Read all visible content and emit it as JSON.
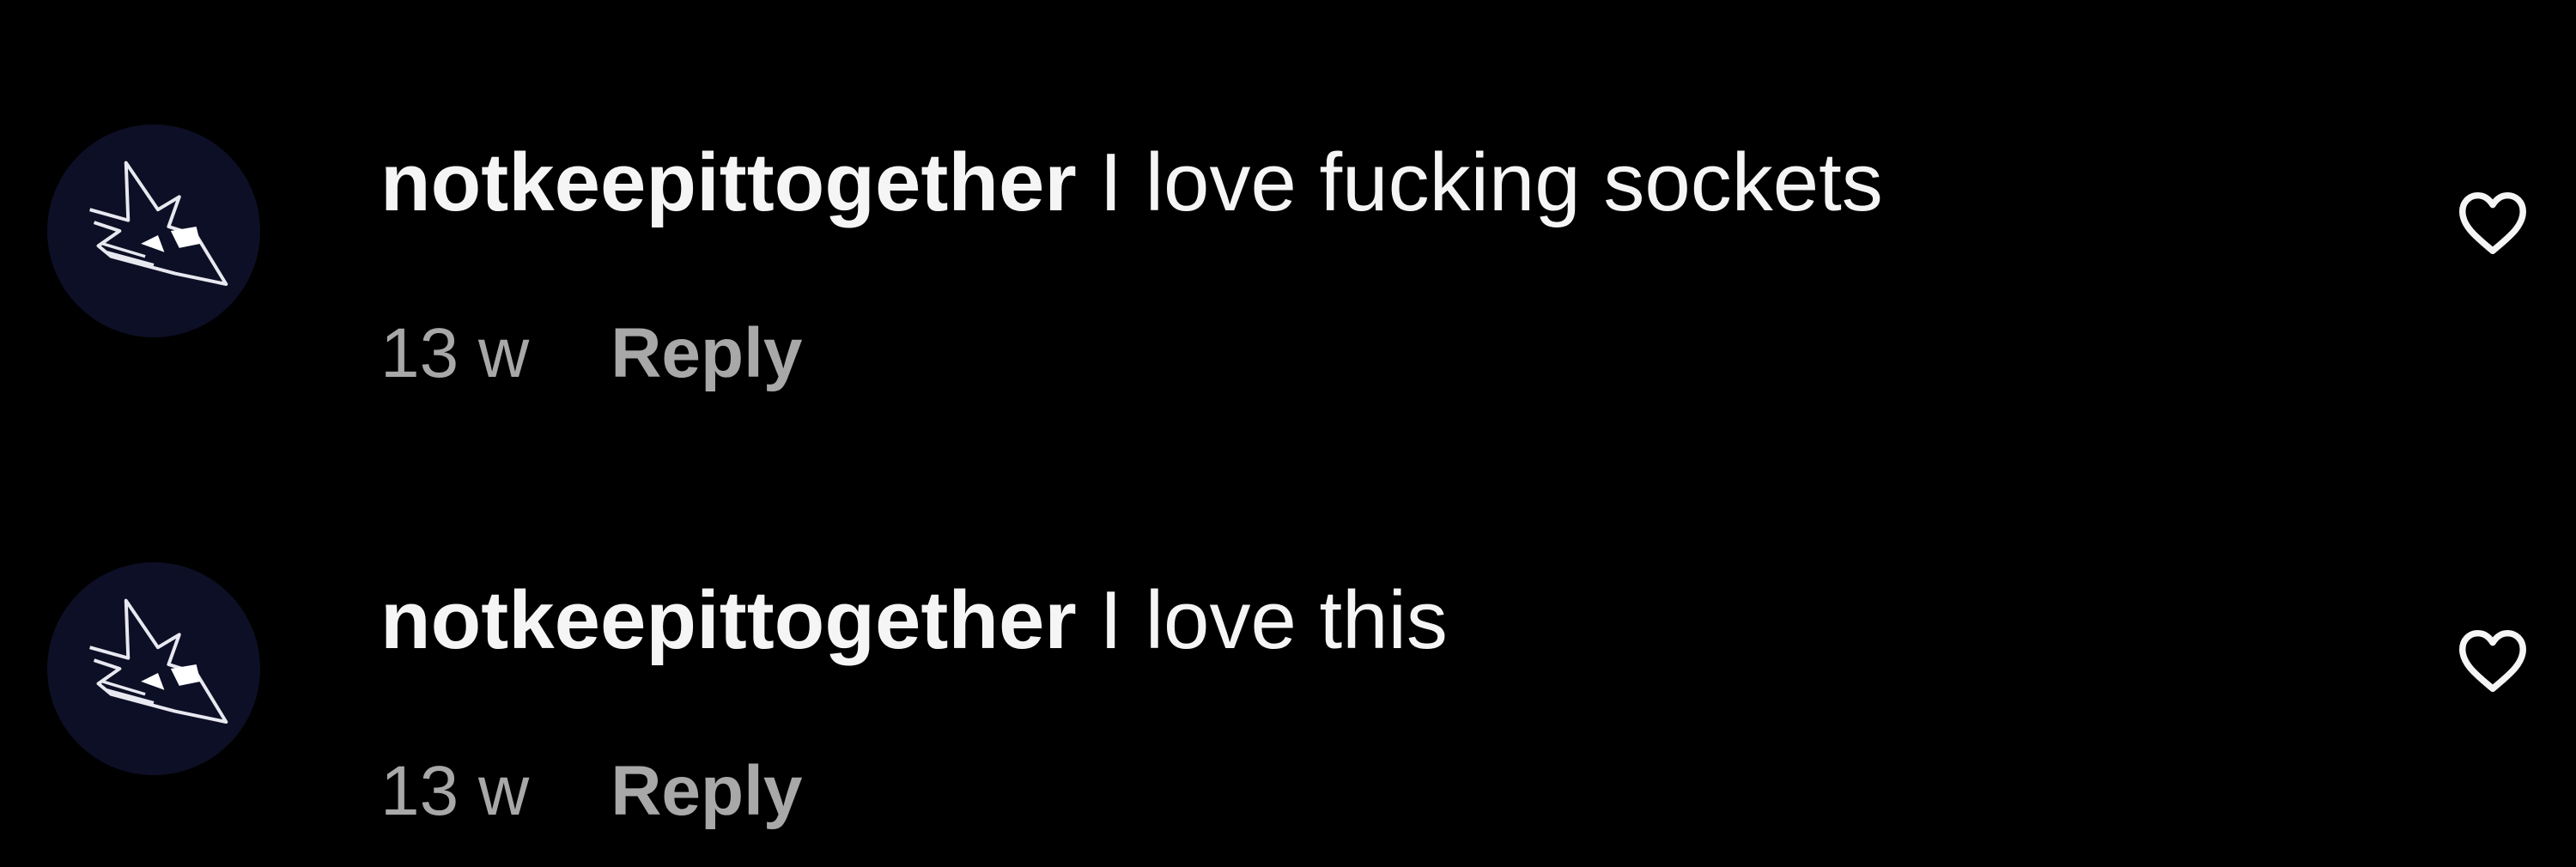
{
  "comments": [
    {
      "username": "notkeepittogether",
      "text": "I love fucking sockets",
      "time": "13 w",
      "reply_label": "Reply",
      "avatar_icon": "spiky-creature-avatar",
      "like_icon": "heart-outline-icon"
    },
    {
      "username": "notkeepittogether",
      "text": "I love this",
      "time": "13 w",
      "reply_label": "Reply",
      "avatar_icon": "spiky-creature-avatar",
      "like_icon": "heart-outline-icon"
    }
  ],
  "colors": {
    "background": "#000000",
    "text_primary": "#f5f5f5",
    "text_secondary": "#a8a8a8",
    "avatar_bg": "#0d0f26"
  }
}
